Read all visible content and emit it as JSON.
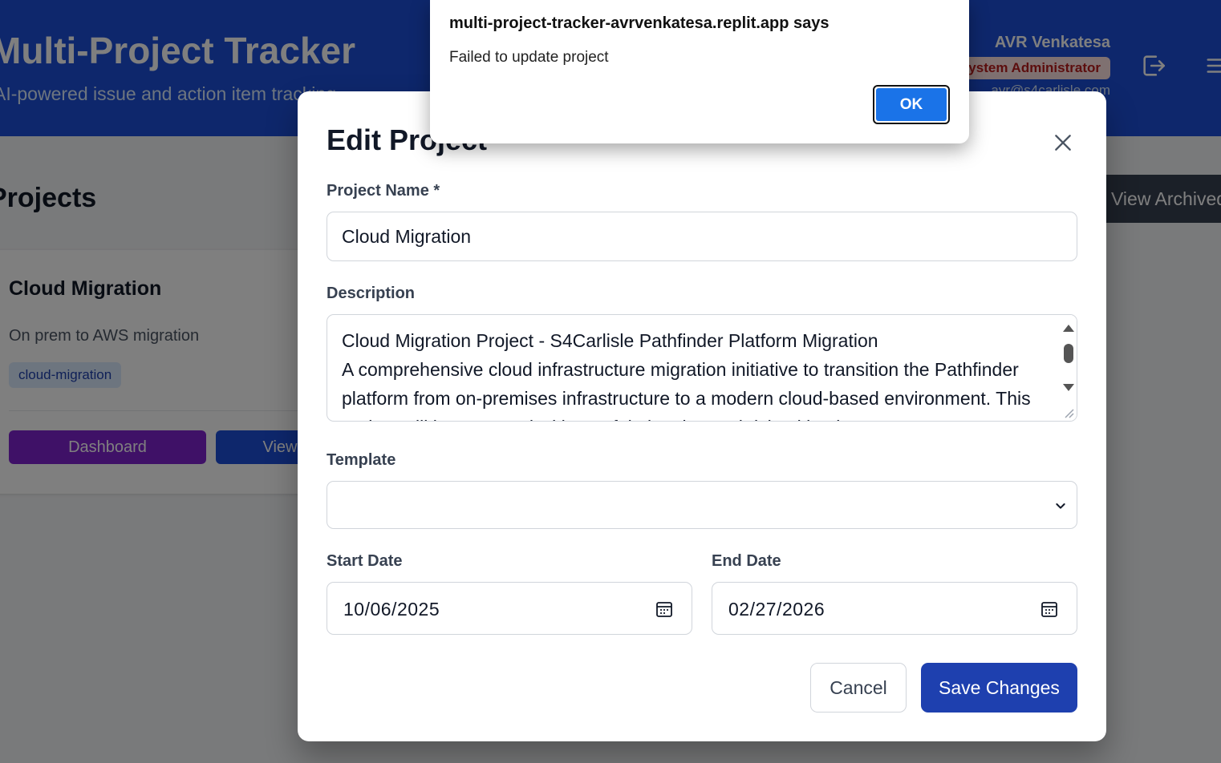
{
  "header": {
    "title": "Multi-Project Tracker",
    "subtitle": "AI-powered issue and action item tracking",
    "user": {
      "name": "AVR Venkatesa",
      "role": "System Administrator",
      "email": "avr@s4carlisle.com"
    },
    "icons": {
      "logout": "logout-icon",
      "menu": "menu-icon"
    }
  },
  "projects_page": {
    "heading": "Projects",
    "view_archived_label": "View Archived",
    "card": {
      "title": "Cloud Migration",
      "description": "On prem to AWS migration",
      "tag": "cloud-migration",
      "dashboard_label": "Dashboard",
      "second_label": "View"
    }
  },
  "modal": {
    "title": "Edit Project",
    "close_icon": "close-icon",
    "project_name_label": "Project Name *",
    "project_name_value": "Cloud Migration",
    "description_label": "Description",
    "description_value": "Cloud Migration Project - S4Carlisle Pathfinder Platform Migration\nA comprehensive cloud infrastructure migration initiative to transition the Pathfinder platform from on-premises infrastructure to a modern cloud-based environment. This project will be executed with careful planning and risk mitigation.",
    "template_label": "Template",
    "template_value": "",
    "start_date_label": "Start Date",
    "start_date_value": "10/06/2025",
    "end_date_label": "End Date",
    "end_date_value": "02/27/2026",
    "cancel_label": "Cancel",
    "save_label": "Save Changes"
  },
  "alert": {
    "origin": "multi-project-tracker-avrvenkatesa.replit.app says",
    "message": "Failed to update project",
    "ok_label": "OK"
  },
  "colors": {
    "header_bg": "#1d4ed8",
    "primary": "#1e40af",
    "dashboard_purple": "#7e22ce",
    "alert_ok_blue": "#1a73e8",
    "role_badge_bg": "#fee2e2",
    "role_badge_text": "#b91c1c"
  }
}
